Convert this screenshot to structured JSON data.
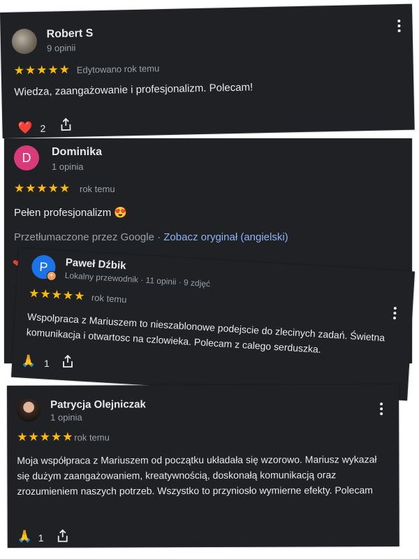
{
  "reviews": [
    {
      "author": "Robert S",
      "meta": "9 opinii",
      "stars": "★★★★★",
      "time": "Edytowano rok temu",
      "text": "Wiedza, zaangażowanie i profesjonalizm. Polecam!",
      "reaction_icon": "heart-icon",
      "reaction_emoji": "❤️",
      "reaction_count": "2"
    },
    {
      "author": "Dominika",
      "avatar_letter": "D",
      "avatar_color": "#d93b7a",
      "meta": "1 opinia",
      "stars": "★★★★★",
      "time": "rok temu",
      "text": "Pełen profesjonalizm 😍",
      "translated_by": "Przetłumaczone przez Google · ",
      "see_original": "Zobacz oryginał (angielski)"
    },
    {
      "author": "Paweł Dźbik",
      "avatar_letter": "P",
      "avatar_color": "#1a73e8",
      "badge_color": "#f29e5c",
      "meta": "Lokalny przewodnik · 11 opinii · 9 zdjęć",
      "stars": "★★★★★",
      "time": "rok temu",
      "text": "Wspolpraca z Mariuszem to nieszablonowe podejscie do zlecinych zadań. Świetna komunikacja i otwartosc na czlowieka. Polecam z calego serduszka.",
      "reaction_icon": "folded-hands-icon",
      "reaction_emoji": "🙏",
      "reaction_count": "1"
    },
    {
      "author": "Patrycja Olejniczak",
      "meta": "1 opinia",
      "stars": "★★★★★",
      "time": "rok temu",
      "text": "Moja współpraca z Mariuszem od początku układała się wzorowo. Mariusz wykazał się dużym zaangażowaniem, kreatywnością, doskonałą komunikacją oraz zrozumieniem naszych potrzeb. Wszystko to przyniosło wymierne efekty. Polecam",
      "reaction_icon": "folded-hands-icon",
      "reaction_emoji": "🙏",
      "reaction_count": "1"
    }
  ],
  "colors": {
    "card_bg": "#202124",
    "star": "#fbbc04",
    "link": "#8ab4f8",
    "secondary_text": "#9aa0a6"
  }
}
